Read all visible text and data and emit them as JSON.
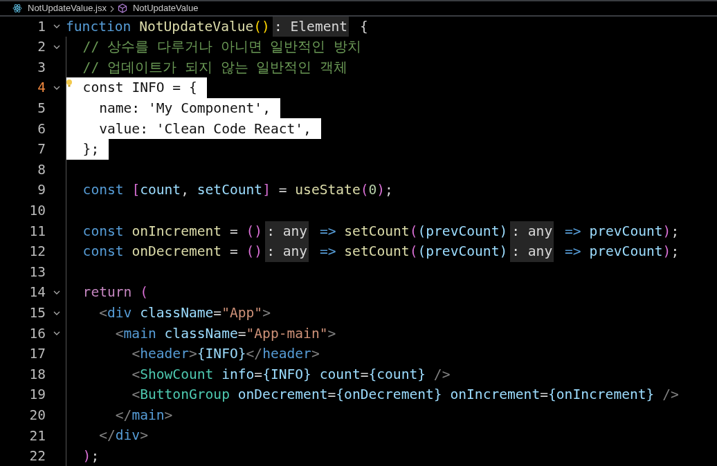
{
  "breadcrumb": [
    {
      "kind": "file",
      "label": "NotUpdateValue.jsx"
    },
    {
      "kind": "symbol",
      "label": "NotUpdateValue"
    }
  ],
  "lines": [
    {
      "n": "1",
      "fold": true,
      "selected": false,
      "current": false,
      "lightbulb": false,
      "tokens": [
        {
          "kind": "kw",
          "text": "function "
        },
        {
          "kind": "fn",
          "text": "NotUpdateValue"
        },
        {
          "kind": "paren",
          "text": "()"
        },
        {
          "kind": "hint",
          "text": ": Element"
        },
        {
          "kind": "p",
          "text": " {"
        }
      ]
    },
    {
      "n": "2",
      "fold": true,
      "selected": false,
      "current": false,
      "lightbulb": false,
      "tokens": [
        {
          "kind": "cm",
          "text": "  // 상수를 다루거나 아니면 일반적인 방치"
        }
      ]
    },
    {
      "n": "3",
      "fold": false,
      "selected": false,
      "current": false,
      "lightbulb": false,
      "tokens": [
        {
          "kind": "cm",
          "text": "  // 업데이트가 되지 않는 일반적인 객체"
        }
      ]
    },
    {
      "n": "4",
      "fold": true,
      "selected": true,
      "current": true,
      "lightbulb": true,
      "tokens": [
        {
          "kind": "kw",
          "text": "  const "
        },
        {
          "kind": "p",
          "text": "INFO = {"
        }
      ]
    },
    {
      "n": "5",
      "fold": false,
      "selected": true,
      "current": false,
      "lightbulb": false,
      "tokens": [
        {
          "kind": "p",
          "text": "    name: "
        },
        {
          "kind": "str",
          "text": "'My Component'"
        },
        {
          "kind": "p",
          "text": ","
        }
      ]
    },
    {
      "n": "6",
      "fold": false,
      "selected": true,
      "current": false,
      "lightbulb": false,
      "tokens": [
        {
          "kind": "p",
          "text": "    value: "
        },
        {
          "kind": "str",
          "text": "'Clean Code React'"
        },
        {
          "kind": "p",
          "text": ","
        }
      ]
    },
    {
      "n": "7",
      "fold": false,
      "selected": true,
      "current": false,
      "lightbulb": false,
      "tokens": [
        {
          "kind": "p",
          "text": "  };"
        }
      ]
    },
    {
      "n": "8",
      "fold": false,
      "selected": false,
      "current": false,
      "lightbulb": false
    },
    {
      "n": "9",
      "fold": false,
      "selected": false,
      "current": false,
      "lightbulb": false,
      "tokens": [
        {
          "kind": "kw",
          "text": "  const "
        },
        {
          "kind": "br",
          "text": "["
        },
        {
          "kind": "var",
          "text": "count"
        },
        {
          "kind": "p",
          "text": ", "
        },
        {
          "kind": "var",
          "text": "setCount"
        },
        {
          "kind": "br",
          "text": "]"
        },
        {
          "kind": "p",
          "text": " = "
        },
        {
          "kind": "fn",
          "text": "useState"
        },
        {
          "kind": "br",
          "text": "("
        },
        {
          "kind": "num",
          "text": "0"
        },
        {
          "kind": "br",
          "text": ")"
        },
        {
          "kind": "p",
          "text": ";"
        }
      ]
    },
    {
      "n": "10",
      "fold": false,
      "selected": false,
      "current": false,
      "lightbulb": false
    },
    {
      "n": "11",
      "fold": false,
      "selected": false,
      "current": false,
      "lightbulb": false,
      "tokens": [
        {
          "kind": "kw",
          "text": "  const "
        },
        {
          "kind": "fn",
          "text": "onIncrement"
        },
        {
          "kind": "p",
          "text": " = "
        },
        {
          "kind": "br",
          "text": "()"
        },
        {
          "kind": "hint",
          "text": ": any"
        },
        {
          "kind": "kw",
          "text": " => "
        },
        {
          "kind": "fn",
          "text": "setCount"
        },
        {
          "kind": "br",
          "text": "("
        },
        {
          "kind": "var",
          "text": "(prevCount)"
        },
        {
          "kind": "hint",
          "text": ": any"
        },
        {
          "kind": "kw",
          "text": " => "
        },
        {
          "kind": "var",
          "text": "prevCount"
        },
        {
          "kind": "br",
          "text": ")"
        },
        {
          "kind": "p",
          "text": ";"
        }
      ]
    },
    {
      "n": "12",
      "fold": false,
      "selected": false,
      "current": false,
      "lightbulb": false,
      "tokens": [
        {
          "kind": "kw",
          "text": "  const "
        },
        {
          "kind": "fn",
          "text": "onDecrement"
        },
        {
          "kind": "p",
          "text": " = "
        },
        {
          "kind": "br",
          "text": "()"
        },
        {
          "kind": "hint",
          "text": ": any"
        },
        {
          "kind": "kw",
          "text": " => "
        },
        {
          "kind": "fn",
          "text": "setCount"
        },
        {
          "kind": "br",
          "text": "("
        },
        {
          "kind": "var",
          "text": "(prevCount)"
        },
        {
          "kind": "hint",
          "text": ": any"
        },
        {
          "kind": "kw",
          "text": " => "
        },
        {
          "kind": "var",
          "text": "prevCount"
        },
        {
          "kind": "br",
          "text": ")"
        },
        {
          "kind": "p",
          "text": ";"
        }
      ]
    },
    {
      "n": "13",
      "fold": false,
      "selected": false,
      "current": false,
      "lightbulb": false
    },
    {
      "n": "14",
      "fold": true,
      "selected": false,
      "current": false,
      "lightbulb": false,
      "tokens": [
        {
          "kind": "ctl",
          "text": "  return "
        },
        {
          "kind": "br",
          "text": "("
        }
      ]
    },
    {
      "n": "15",
      "fold": true,
      "selected": false,
      "current": false,
      "lightbulb": false,
      "tokens": [
        {
          "kind": "tag",
          "text": "    <"
        },
        {
          "kind": "tn",
          "text": "div "
        },
        {
          "kind": "attr",
          "text": "className"
        },
        {
          "kind": "p",
          "text": "="
        },
        {
          "kind": "str",
          "text": "\"App\""
        },
        {
          "kind": "tag",
          "text": ">"
        }
      ]
    },
    {
      "n": "16",
      "fold": true,
      "selected": false,
      "current": false,
      "lightbulb": false,
      "tokens": [
        {
          "kind": "tag",
          "text": "      <"
        },
        {
          "kind": "tn",
          "text": "main "
        },
        {
          "kind": "attr",
          "text": "className"
        },
        {
          "kind": "p",
          "text": "="
        },
        {
          "kind": "str",
          "text": "\"App-main\""
        },
        {
          "kind": "tag",
          "text": ">"
        }
      ]
    },
    {
      "n": "17",
      "fold": false,
      "selected": false,
      "current": false,
      "lightbulb": false,
      "tokens": [
        {
          "kind": "tag",
          "text": "        <"
        },
        {
          "kind": "tn",
          "text": "header"
        },
        {
          "kind": "tag",
          "text": ">"
        },
        {
          "kind": "var",
          "text": "{INFO}"
        },
        {
          "kind": "tag",
          "text": "</"
        },
        {
          "kind": "tn",
          "text": "header"
        },
        {
          "kind": "tag",
          "text": ">"
        }
      ]
    },
    {
      "n": "18",
      "fold": false,
      "selected": false,
      "current": false,
      "lightbulb": false,
      "tokens": [
        {
          "kind": "tag",
          "text": "        <"
        },
        {
          "kind": "comp",
          "text": "ShowCount "
        },
        {
          "kind": "attr",
          "text": "info"
        },
        {
          "kind": "p",
          "text": "="
        },
        {
          "kind": "var",
          "text": "{INFO} "
        },
        {
          "kind": "attr",
          "text": "count"
        },
        {
          "kind": "p",
          "text": "="
        },
        {
          "kind": "var",
          "text": "{count} "
        },
        {
          "kind": "tag",
          "text": "/>"
        }
      ]
    },
    {
      "n": "19",
      "fold": false,
      "selected": false,
      "current": false,
      "lightbulb": false,
      "tokens": [
        {
          "kind": "tag",
          "text": "        <"
        },
        {
          "kind": "comp",
          "text": "ButtonGroup "
        },
        {
          "kind": "attr",
          "text": "onDecrement"
        },
        {
          "kind": "p",
          "text": "="
        },
        {
          "kind": "var",
          "text": "{onDecrement} "
        },
        {
          "kind": "attr",
          "text": "onIncrement"
        },
        {
          "kind": "p",
          "text": "="
        },
        {
          "kind": "var",
          "text": "{onIncrement} "
        },
        {
          "kind": "tag",
          "text": "/>"
        }
      ]
    },
    {
      "n": "20",
      "fold": false,
      "selected": false,
      "current": false,
      "lightbulb": false,
      "tokens": [
        {
          "kind": "tag",
          "text": "      </"
        },
        {
          "kind": "tn",
          "text": "main"
        },
        {
          "kind": "tag",
          "text": ">"
        }
      ]
    },
    {
      "n": "21",
      "fold": false,
      "selected": false,
      "current": false,
      "lightbulb": false,
      "tokens": [
        {
          "kind": "tag",
          "text": "    </"
        },
        {
          "kind": "tn",
          "text": "div"
        },
        {
          "kind": "tag",
          "text": ">"
        }
      ]
    },
    {
      "n": "22",
      "fold": false,
      "selected": false,
      "current": false,
      "lightbulb": false,
      "tokens": [
        {
          "kind": "br",
          "text": "  )"
        },
        {
          "kind": "p",
          "text": ";"
        }
      ]
    }
  ]
}
